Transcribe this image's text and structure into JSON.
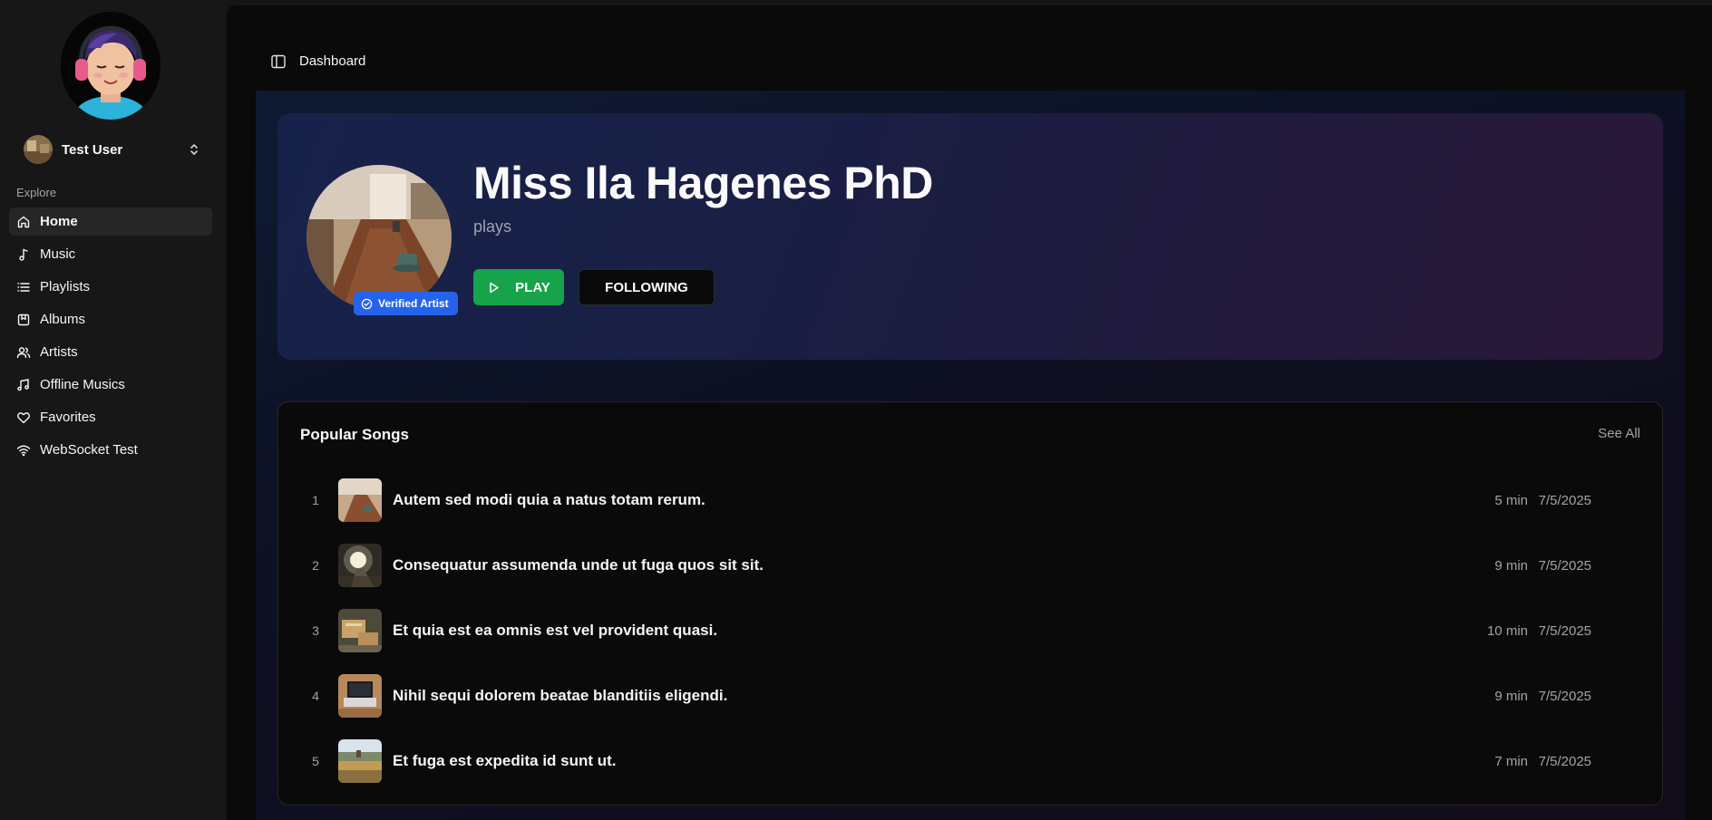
{
  "sidebar": {
    "user_name": "Test User",
    "section_label": "Explore",
    "items": [
      {
        "label": "Home",
        "icon": "home-icon"
      },
      {
        "label": "Music",
        "icon": "music-note-icon"
      },
      {
        "label": "Playlists",
        "icon": "list-icon"
      },
      {
        "label": "Albums",
        "icon": "album-book-icon"
      },
      {
        "label": "Artists",
        "icon": "users-icon"
      },
      {
        "label": "Offline Musics",
        "icon": "music-notes-icon"
      },
      {
        "label": "Favorites",
        "icon": "heart-icon"
      },
      {
        "label": "WebSocket Test",
        "icon": "wifi-icon"
      }
    ],
    "active_item": "Home"
  },
  "header": {
    "breadcrumb": "Dashboard"
  },
  "artist": {
    "name": "Miss Ila Hagenes PhD",
    "subtitle": "plays",
    "badge": "Verified Artist",
    "play_label": "PLAY",
    "follow_label": "FOLLOWING"
  },
  "popular_songs": {
    "title": "Popular Songs",
    "see_all": "See All",
    "songs": [
      {
        "index": "1",
        "title": "Autem sed modi quia a natus totam rerum.",
        "duration": "5 min",
        "date": "7/5/2025"
      },
      {
        "index": "2",
        "title": "Consequatur assumenda unde ut fuga quos sit sit.",
        "duration": "9 min",
        "date": "7/5/2025"
      },
      {
        "index": "3",
        "title": "Et quia est ea omnis est vel provident quasi.",
        "duration": "10 min",
        "date": "7/5/2025"
      },
      {
        "index": "4",
        "title": "Nihil sequi dolorem beatae blanditiis eligendi.",
        "duration": "9 min",
        "date": "7/5/2025"
      },
      {
        "index": "5",
        "title": "Et fuga est expedita id sunt ut.",
        "duration": "7 min",
        "date": "7/5/2025"
      }
    ]
  },
  "colors": {
    "accent_green": "#16a34a",
    "verified_blue": "#2563eb",
    "background": "#0a0a0a"
  }
}
